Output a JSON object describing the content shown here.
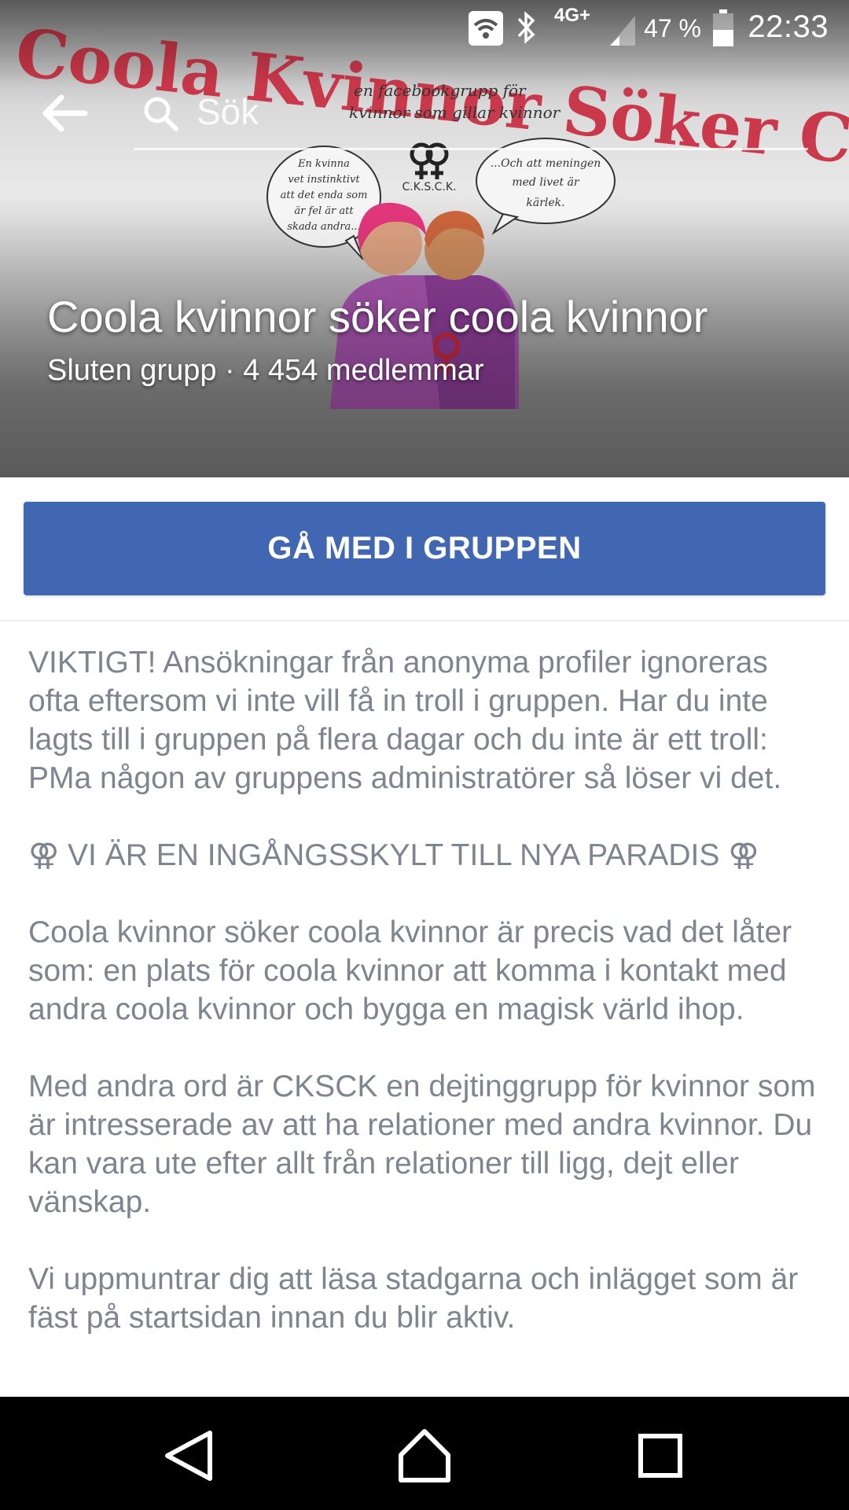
{
  "status_bar": {
    "network": "4G+",
    "battery": "47 %",
    "time": "22:33",
    "icons": [
      "wifi-icon",
      "bluetooth-icon",
      "signal-icon",
      "battery-icon"
    ]
  },
  "search": {
    "placeholder": "Sök"
  },
  "cover": {
    "banner_text": "Coola Kvinnor Söker Coola Kvinnor",
    "caption_top": "en facebookgrupp för",
    "caption_bottom": "kvinnor som gillar kvinnor",
    "bubble_left": [
      "En kvinna",
      "vet instinktivt",
      "att det enda som",
      "är fel är att",
      "skada andra..."
    ],
    "bubble_right": [
      "...Och att meningen",
      "med livet är",
      "kärlek."
    ],
    "logo_text": "C.K.S.C.K."
  },
  "group": {
    "title": "Coola kvinnor söker coola kvinnor",
    "meta": "Sluten grupp · 4 454 medlemmar"
  },
  "join_button": {
    "label": "GÅ MED I GRUPPEN"
  },
  "description": {
    "paragraphs": [
      "VIKTIGT! Ansökningar från anonyma profiler ignoreras ofta eftersom vi inte vill få in troll i gruppen. Har du inte lagts till i gruppen på flera dagar och du inte är ett troll: PMa någon av gruppens administratörer så löser vi det.",
      "⚢ VI ÄR EN INGÅNGSSKYLT TILL NYA PARADIS ⚢",
      "Coola kvinnor söker coola kvinnor är precis vad det låter som: en plats för coola kvinnor att komma i kontakt med andra coola kvinnor och bygga en magisk värld ihop.",
      "Med andra ord är CKSCK en dejtinggrupp för kvinnor som är intresserade av att ha relationer med andra kvinnor. Du kan vara ute efter allt från relationer till ligg, dejt eller vänskap.",
      "Vi uppmuntrar dig att läsa stadgarna och inlägget som är fäst på startsidan innan du blir aktiv."
    ]
  },
  "nav_bar": {
    "buttons": [
      "back-nav-icon",
      "home-nav-icon",
      "recents-nav-icon"
    ]
  },
  "colors": {
    "primary": "#4267b2",
    "text_muted": "#7f8590",
    "banner_red": "#c8283c",
    "banner_pink": "#b0306e"
  }
}
